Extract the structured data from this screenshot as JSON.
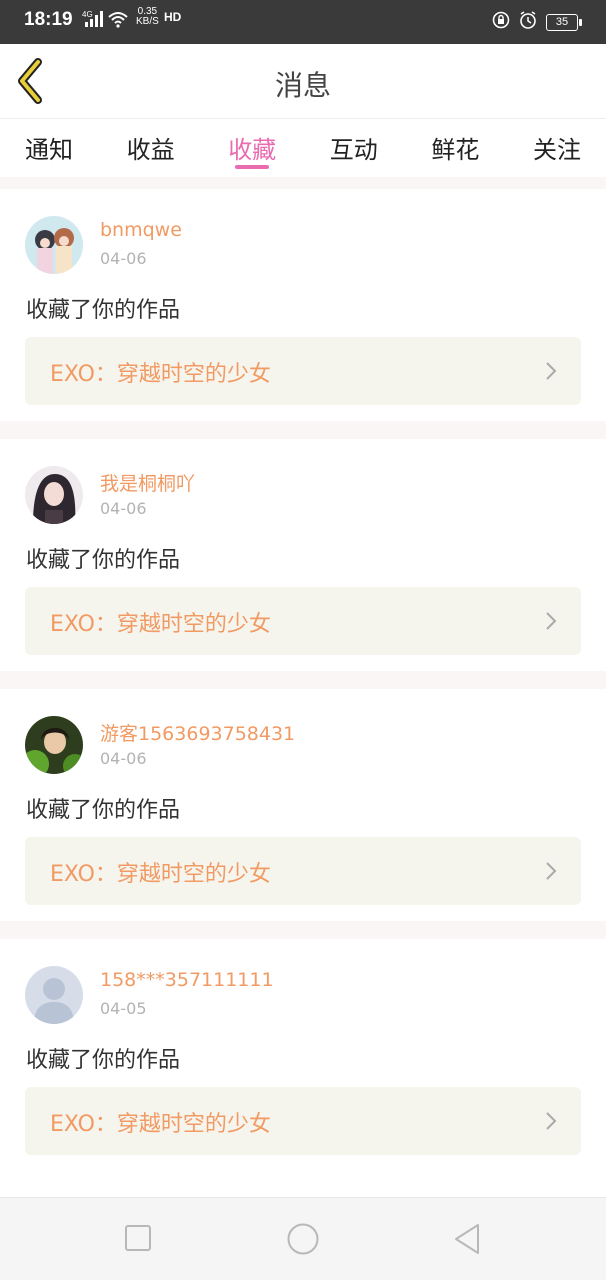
{
  "status_bar": {
    "time": "18:19",
    "network": "4G",
    "speed_value": "0.35",
    "speed_unit": "KB/S",
    "hd": "HD",
    "battery": "35"
  },
  "header": {
    "title": "消息",
    "back_icon": "chevron-left-icon"
  },
  "tabs": [
    {
      "label": "通知"
    },
    {
      "label": "收益"
    },
    {
      "label": "收藏",
      "active": true
    },
    {
      "label": "互动"
    },
    {
      "label": "鲜花"
    },
    {
      "label": "关注"
    }
  ],
  "messages": [
    {
      "username": "bnmqwe",
      "date": "04-06",
      "action": "收藏了你的作品",
      "work_title": "EXO：穿越时空的少女"
    },
    {
      "username": "我是桐桐吖",
      "date": "04-06",
      "action": "收藏了你的作品",
      "work_title": "EXO：穿越时空的少女"
    },
    {
      "username": "游客1563693758431",
      "date": "04-06",
      "action": "收藏了你的作品",
      "work_title": "EXO：穿越时空的少女"
    },
    {
      "username": "158***357111111",
      "date": "04-05",
      "action": "收藏了你的作品",
      "work_title": "EXO：穿越时空的少女"
    }
  ],
  "nav_bar": {
    "recent_icon": "square-icon",
    "home_icon": "circle-icon",
    "back_icon": "triangle-back-icon"
  },
  "colors": {
    "accent_pink": "#ea6bb0",
    "username_orange": "#f29a63",
    "back_arrow_yellow": "#e8cf3a"
  }
}
